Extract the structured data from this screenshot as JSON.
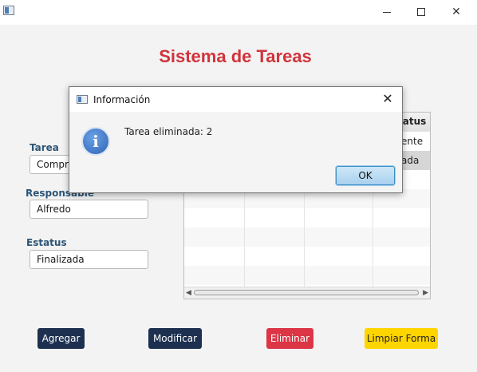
{
  "window": {
    "title": ""
  },
  "header": {
    "title": "Sistema de Tareas"
  },
  "form": {
    "tarea": {
      "label": "Tarea",
      "value": "Compra"
    },
    "responsable": {
      "label": "Responsable",
      "value": "Alfredo"
    },
    "estatus": {
      "label": "Estatus",
      "value": "Finalizada"
    }
  },
  "table": {
    "header_visible": "tatus",
    "rows": [
      {
        "estatus": "ente"
      },
      {
        "estatus": "ada"
      }
    ]
  },
  "buttons": {
    "agregar": "Agregar",
    "modificar": "Modificar",
    "eliminar": "Eliminar",
    "limpiar": "Limpiar Forma"
  },
  "dialog": {
    "title": "Información",
    "message": "Tarea eliminada: 2",
    "ok": "OK",
    "icon_glyph": "i"
  },
  "colors": {
    "title_red": "#d2333b",
    "label_blue": "#2d5577",
    "navy": "#1e3050",
    "danger": "#dc3545",
    "warning": "#ffd500",
    "selected_row": "#d6d6d6"
  }
}
